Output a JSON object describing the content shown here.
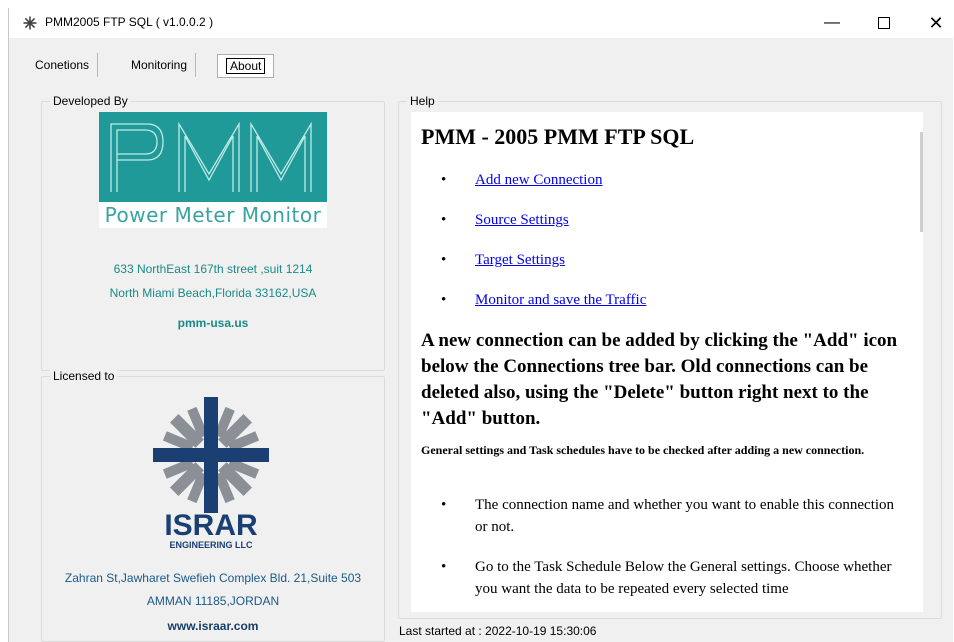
{
  "window": {
    "title": "PMM2005 FTP SQL ( v1.0.0.2 )",
    "controls": {
      "minimize": "—",
      "close": "✕"
    }
  },
  "tabs": [
    {
      "label": "Conetions"
    },
    {
      "label": "Monitoring"
    },
    {
      "label": "About",
      "selected": true
    }
  ],
  "developed_by": {
    "label": "Developed By",
    "logo_text": "PMM",
    "logo_subtitle": "Power Meter Monitor",
    "address_line1": "633 NorthEast 167th street ,suit 1214",
    "address_line2": "North Miami Beach,Florida 33162,USA",
    "website": "pmm-usa.us"
  },
  "licensed_to": {
    "label": "Licensed to",
    "logo_name": "ISRAR",
    "logo_sub": "ENGINEERING LLC",
    "address_line1": "Zahran St,Jawharet Swefieh  Complex Bld. 21,Suite 503",
    "address_line2": "AMMAN 11185,JORDAN",
    "website": "www.israar.com"
  },
  "help": {
    "label": "Help",
    "title": "PMM - 2005 PMM FTP SQL",
    "links": [
      "Add new Connection",
      "Source Settings",
      "Target Settings",
      "Monitor and save the Traffic"
    ],
    "paragraph": "A new connection can be added by clicking the \"Add\" icon below the Connections tree bar. Old connections can be deleted also, using the \"Delete\" button right next to the \"Add\" button.",
    "small_note": "General settings and Task schedules have to be checked after adding a new connection.",
    "bullets": [
      "The connection name and whether you want to enable this connection or not.",
      "Go to the Task Schedule Below the General settings. Choose whether you want the data to be repeated every selected time"
    ]
  },
  "status": {
    "last_started": "Last started at : 2022-10-19 15:30:06"
  },
  "colors": {
    "teal": "#1f9a98",
    "link": "#0000ee",
    "israr_navy": "#1b3f73"
  }
}
